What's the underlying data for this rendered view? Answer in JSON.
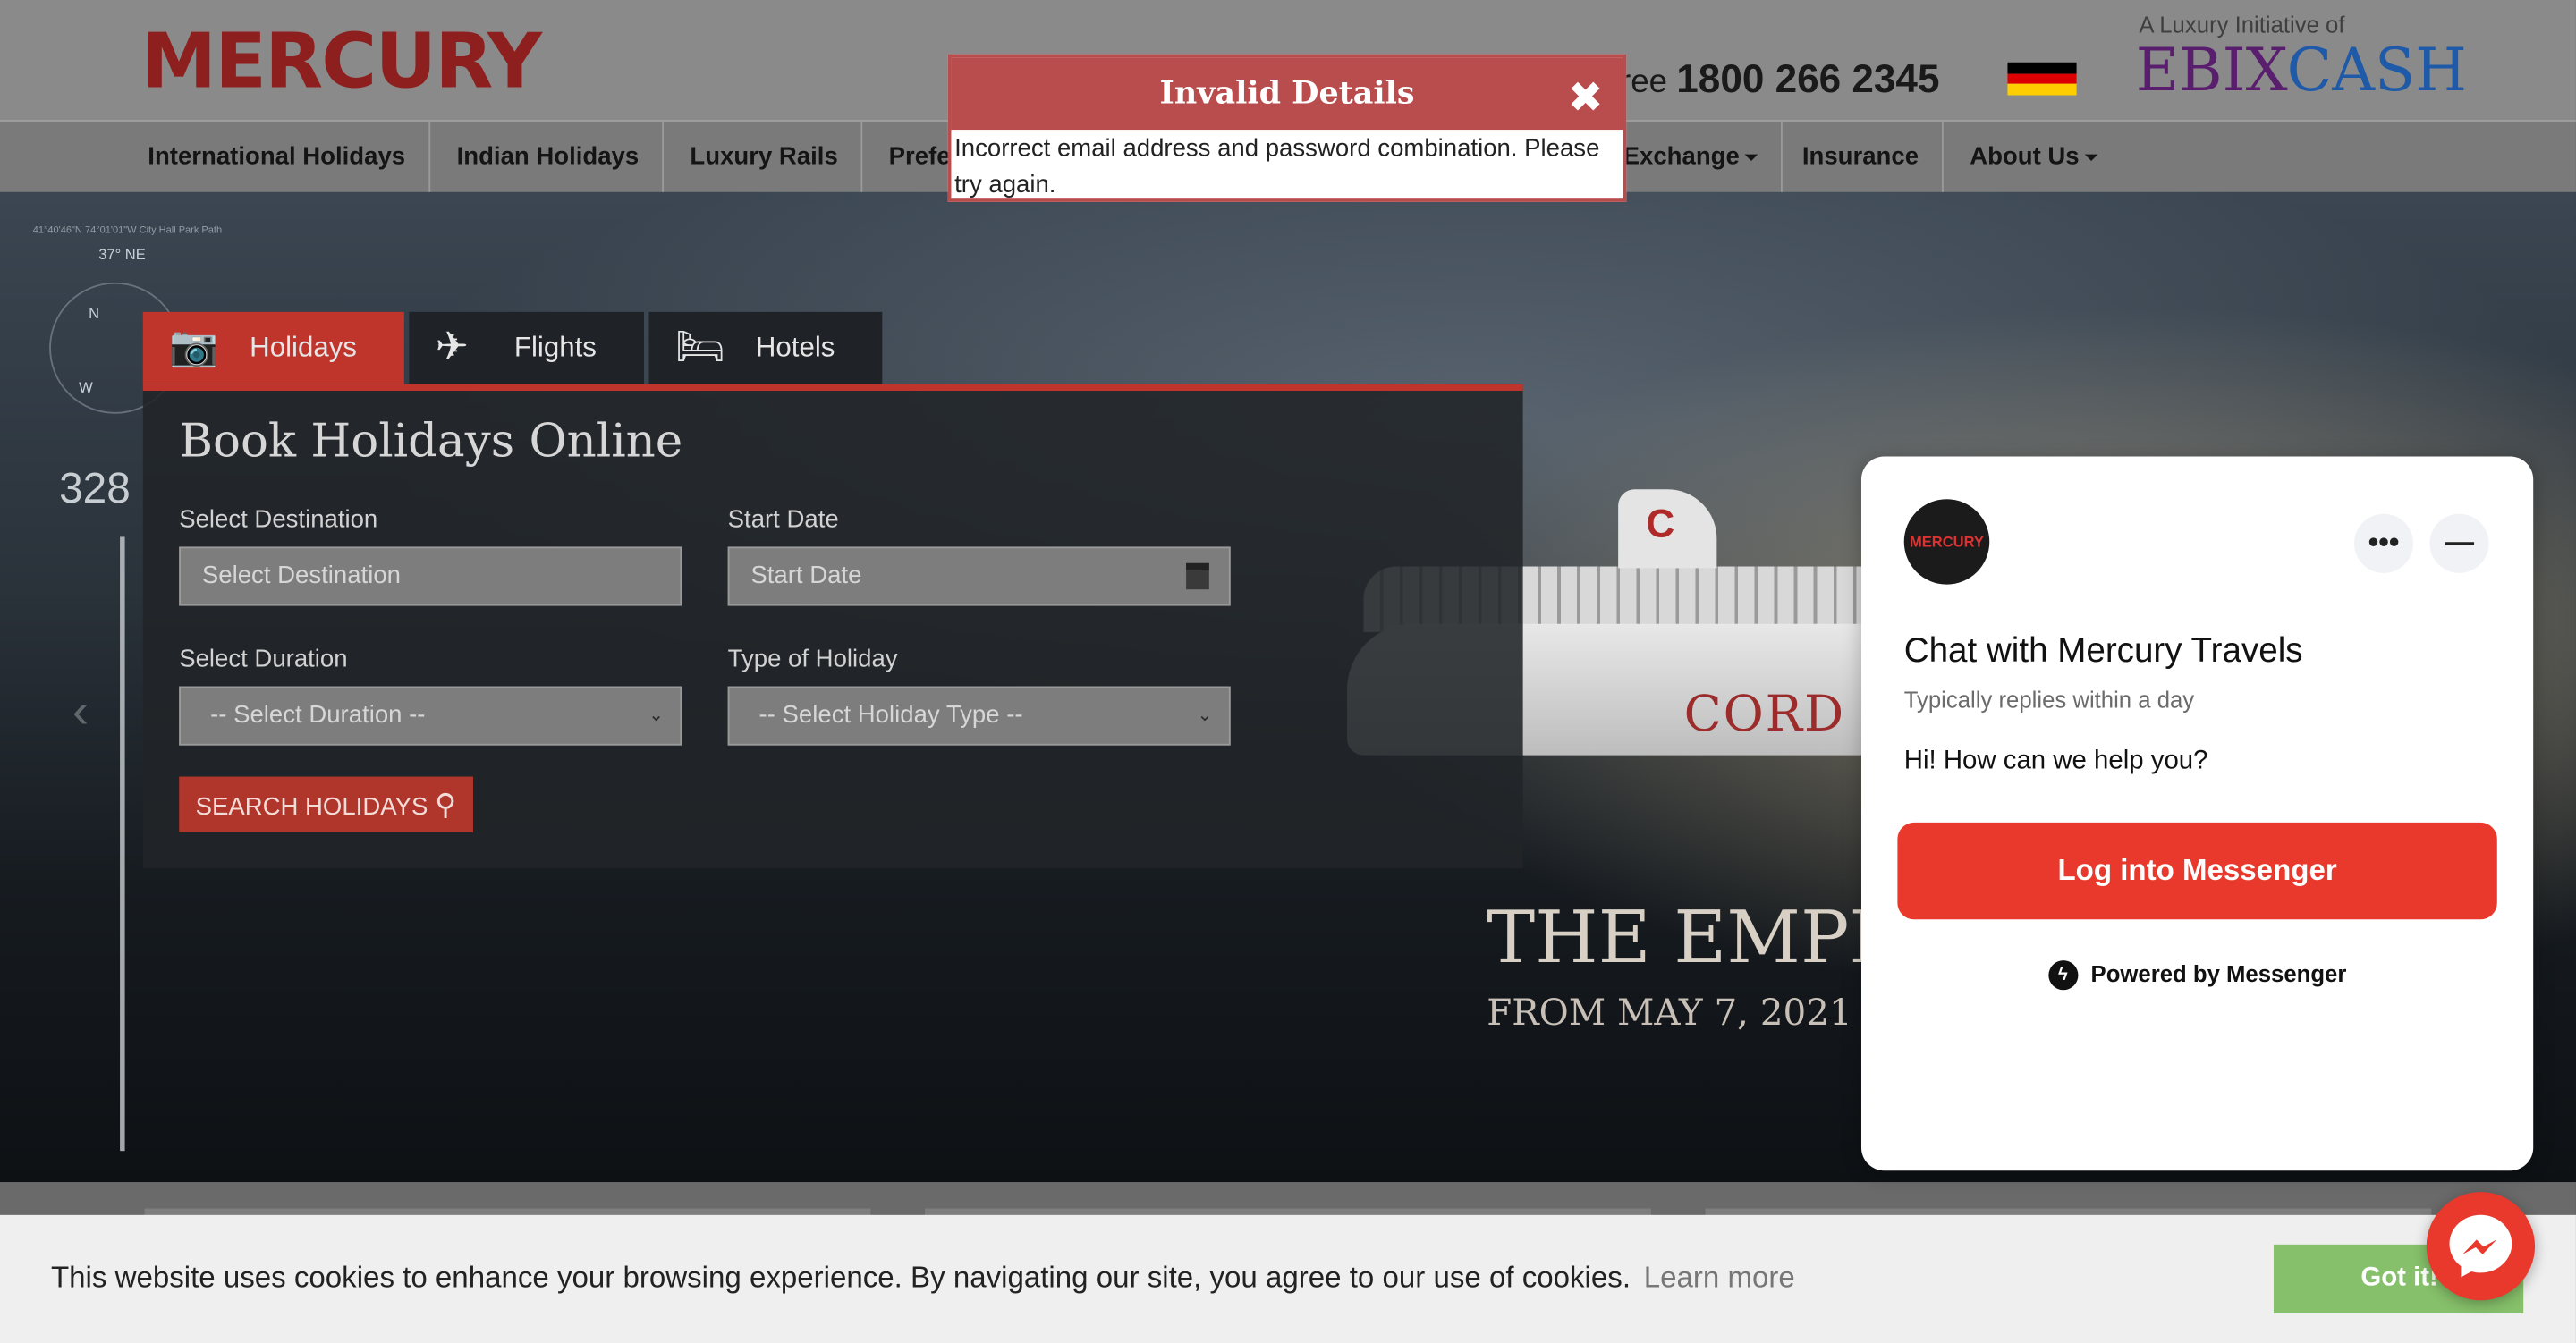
{
  "header": {
    "logo": "MERCURY",
    "tollfree_prefix": "ree",
    "tollfree_number": "1800 266 2345",
    "luxury_tag": "A Luxury Initiative of",
    "ebix_part1": "EBIX",
    "ebix_part2": "CASH",
    "flag_colors": [
      "#000000",
      "#dd0000",
      "#ffce00"
    ]
  },
  "nav": {
    "items": [
      {
        "label": "International Holidays"
      },
      {
        "label": "Indian Holidays"
      },
      {
        "label": "Luxury Rails"
      },
      {
        "label": "Prefe"
      },
      {
        "label": "Exchange"
      },
      {
        "label": "Insurance"
      },
      {
        "label": "About Us"
      }
    ]
  },
  "hero": {
    "compass_coords": "41°40'46\"N 74°01'01\"W City Hall Park Path",
    "compass_deg": "37° NE",
    "compass_n": "N",
    "compass_w": "W",
    "side_number": "328",
    "ship_name": "CORD",
    "headline": "THE EMPR",
    "subline": "FROM MAY 7, 2021"
  },
  "booking": {
    "tabs": [
      {
        "label": "Holidays",
        "icon": "camera-icon",
        "glyph": "📷"
      },
      {
        "label": "Flights",
        "icon": "plane-icon",
        "glyph": "✈"
      },
      {
        "label": "Hotels",
        "icon": "bed-icon",
        "glyph": "🛏"
      }
    ],
    "title": "Book Holidays Online",
    "destination_label": "Select Destination",
    "destination_placeholder": "Select Destination",
    "start_date_label": "Start Date",
    "start_date_placeholder": "Start Date",
    "duration_label": "Select Duration",
    "duration_value": "-- Select Duration --",
    "holiday_type_label": "Type of Holiday",
    "holiday_type_value": "-- Select Holiday Type --",
    "search_button": "SEARCH HOLIDAYS"
  },
  "modal": {
    "title": "Invalid Details",
    "close": "✖",
    "message": "Incorrect email address and password combination. Please try again."
  },
  "chat": {
    "avatar_text": "MERCURY",
    "more_button": "•••",
    "minimize_button": "—",
    "title": "Chat with Mercury Travels",
    "subtitle": "Typically replies within a day",
    "message": "Hi! How can we help you?",
    "login_button": "Log into Messenger",
    "powered_by": "Powered by Messenger"
  },
  "cookie": {
    "text": "This website uses cookies to enhance your browsing experience. By navigating our site, you agree to our use of cookies.",
    "learn_more": "Learn more",
    "button": "Got it!"
  },
  "colors": {
    "brand_red": "#c0352b",
    "messenger_red": "#e8392c",
    "cookie_green": "#86c06a"
  }
}
